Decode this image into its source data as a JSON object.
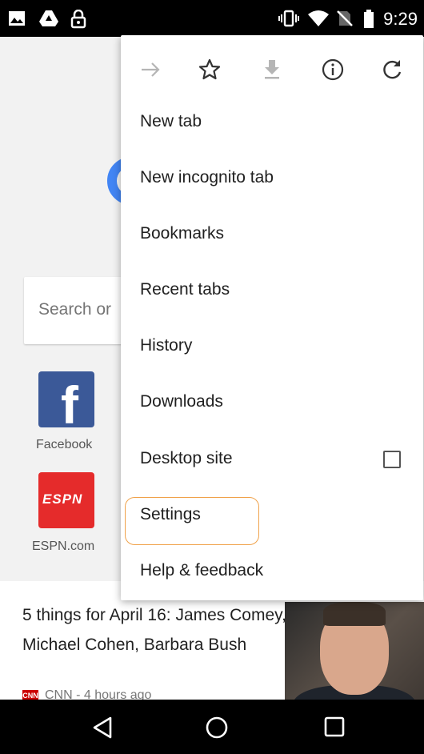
{
  "status_bar": {
    "time": "9:29",
    "left_icons": [
      "image-icon",
      "drive-icon",
      "lock-icon"
    ],
    "right_icons": [
      "vibrate-icon",
      "wifi-icon",
      "no-sim-icon",
      "battery-icon"
    ]
  },
  "background": {
    "search_placeholder": "Search or",
    "tiles": [
      {
        "label": "Facebook",
        "icon": "facebook-icon"
      },
      {
        "label": "ESPN.com",
        "icon": "espn-icon"
      }
    ],
    "article": {
      "title": "5 things for April 16: James Comey, Michael Cohen, Barbara Bush",
      "source": "CNN - 4 hours ago"
    }
  },
  "menu": {
    "toolbar_icons": [
      "forward-icon",
      "bookmark-star-icon",
      "download-icon",
      "info-icon",
      "refresh-icon"
    ],
    "items": [
      {
        "label": "New tab"
      },
      {
        "label": "New incognito tab"
      },
      {
        "label": "Bookmarks"
      },
      {
        "label": "Recent tabs"
      },
      {
        "label": "History"
      },
      {
        "label": "Downloads"
      },
      {
        "label": "Desktop site",
        "checked": false
      },
      {
        "label": "Settings"
      },
      {
        "label": "Help & feedback"
      }
    ]
  },
  "nav_bar": {
    "icons": [
      "back-icon",
      "home-icon",
      "recents-icon"
    ]
  },
  "colors": {
    "highlight_outline": "#f0a24a",
    "facebook": "#3b5998",
    "espn": "#e52b2b"
  }
}
